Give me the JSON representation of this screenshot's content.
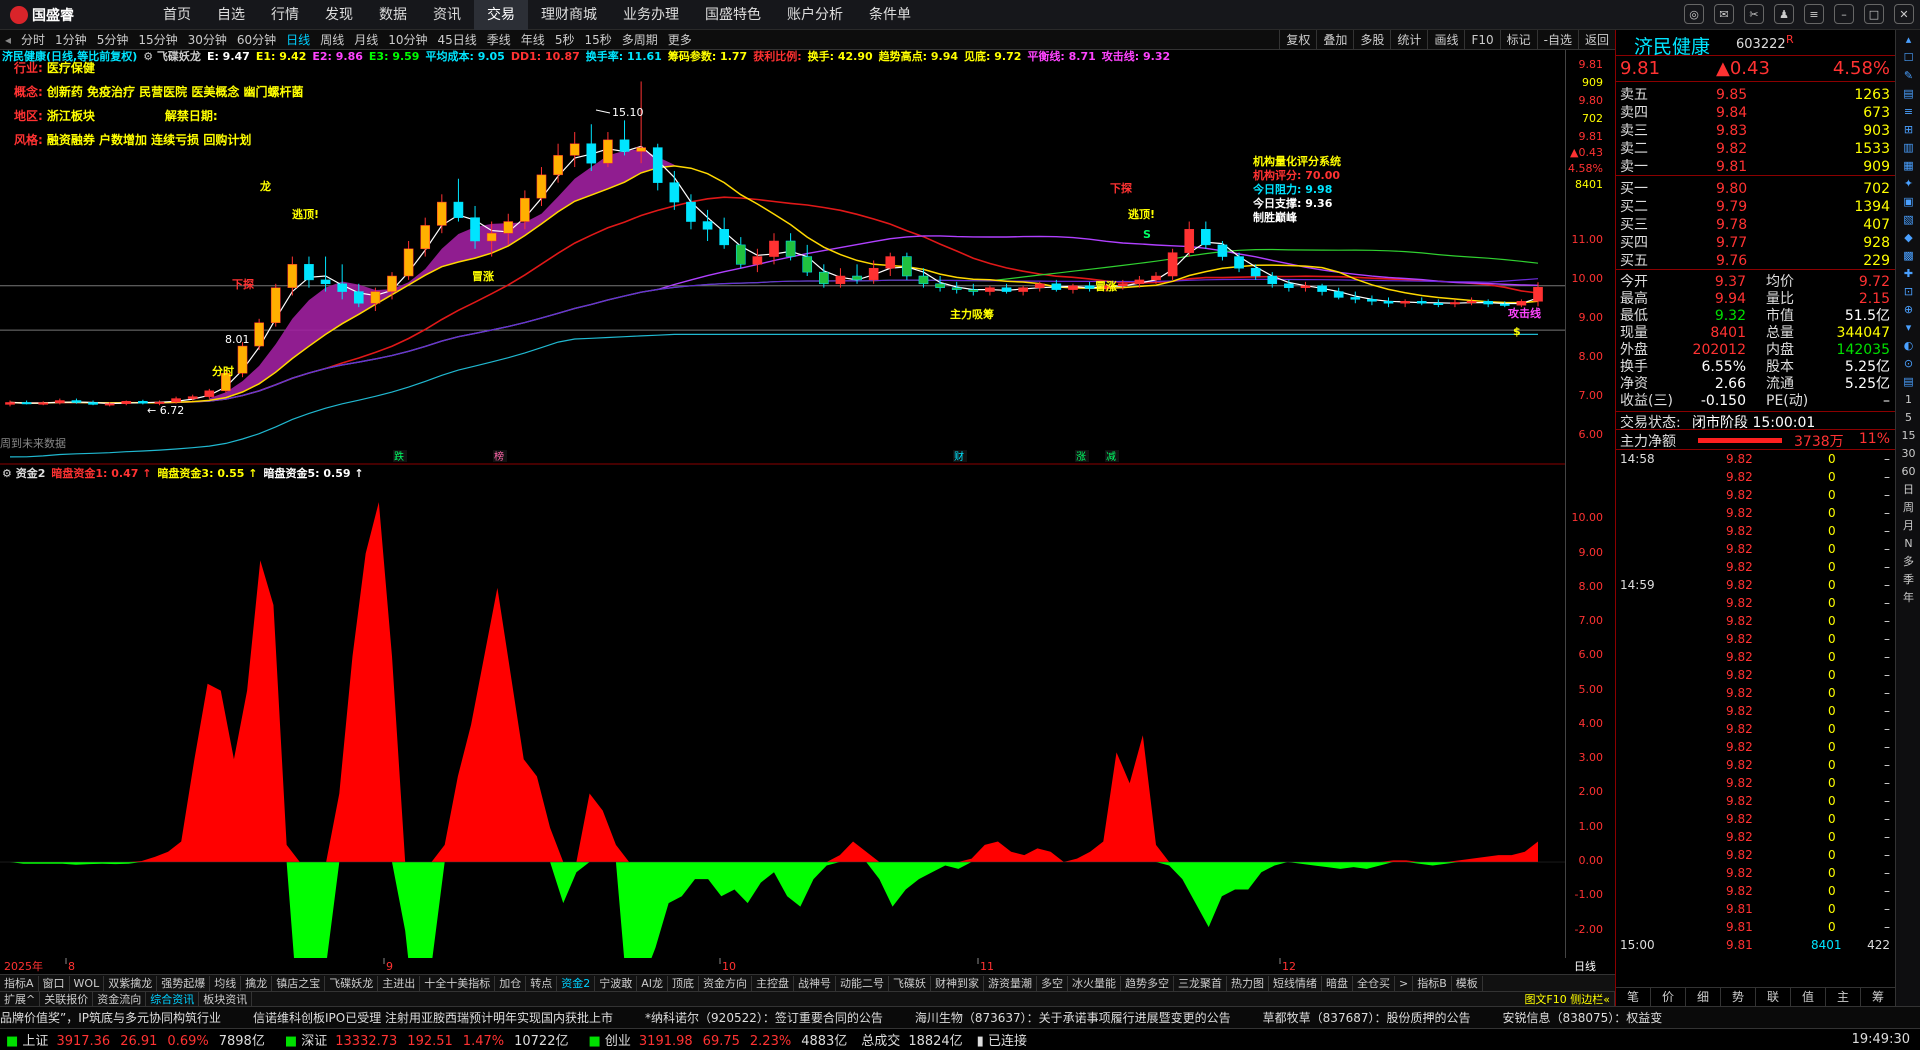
{
  "menubar": {
    "logo": "国盛睿",
    "items": [
      "首页",
      "自选",
      "行情",
      "发现",
      "数据",
      "资讯",
      "交易",
      "理财商城",
      "业务办理",
      "国盛特色",
      "账户分析",
      "条件单"
    ],
    "active": "交易"
  },
  "periods": {
    "items": [
      "分时",
      "1分钟",
      "5分钟",
      "15分钟",
      "30分钟",
      "60分钟",
      "日线",
      "周线",
      "月线",
      "10分钟",
      "45日线",
      "季线",
      "年线",
      "5秒",
      "15秒",
      "多周期",
      "更多"
    ],
    "active": "日线"
  },
  "toolbar": [
    "复权",
    "叠加",
    "多股",
    "统计",
    "画线",
    "F10",
    "标记",
    "-自选",
    "返回"
  ],
  "kline": {
    "title": "济民健康(日线,等比前复权)",
    "indicator_name": "飞碟妖龙",
    "params": [
      {
        "t": "E: 9.47",
        "c": "#ffffff"
      },
      {
        "t": "E1: 9.42",
        "c": "#ffff00"
      },
      {
        "t": "E2: 9.86",
        "c": "#ff44ff"
      },
      {
        "t": "E3: 9.59",
        "c": "#00ff00"
      },
      {
        "t": "平均成本: 9.05",
        "c": "#00e5ff"
      },
      {
        "t": "DD1: 10.87",
        "c": "#ff3232"
      },
      {
        "t": "换手率: 11.61",
        "c": "#00e5ff"
      },
      {
        "t": "筹码参数: 1.77",
        "c": "#ffff00"
      },
      {
        "t": "获利比例:",
        "c": "#ff3232"
      },
      {
        "t": "换手: 42.90",
        "c": "#ffff00"
      },
      {
        "t": "趋势高点: 9.94",
        "c": "#ffff00"
      },
      {
        "t": "见底: 9.72",
        "c": "#ffff00"
      },
      {
        "t": "平衡线: 8.71",
        "c": "#ff44ff"
      },
      {
        "t": "攻击线: 9.32",
        "c": "#ff44ff"
      }
    ],
    "info": [
      {
        "k": "行业:",
        "v": "医疗保健"
      },
      {
        "k": "概念:",
        "v": "创新药 免疫治疗 民营医院 医美概念 幽门螺杆菌"
      },
      {
        "k": "地区:",
        "v": "浙江板块",
        "k2": "解禁日期:"
      },
      {
        "k": "风格:",
        "v": "融资融券 户数增加 连续亏损 回购计划"
      }
    ],
    "system": {
      "title": "机构量化评分系统",
      "score": "机构评分: 70.00",
      "resist": "今日阻力: 9.98",
      "support": "今日支撑: 9.36",
      "note": "制胜巅峰"
    },
    "high_label": "15.10",
    "low_label": "6.72",
    "mid_label": "8.01",
    "annotations": [
      "逃顶!",
      "逃顶!",
      "下探",
      "下探",
      "冒涨",
      "冒涨",
      "主力吸筹",
      "攻击线",
      "龙",
      "分时",
      "$",
      "S"
    ],
    "events": [
      "跌",
      "榜",
      "财",
      "涨",
      "减"
    ],
    "no_data_text": "周到未来数据",
    "price_axis": [
      "9.81",
      "909",
      "9.80",
      "702",
      "9.81",
      "▲0.43",
      "4.58%",
      "8401",
      "11.00",
      "10.00",
      "9.00",
      "8.00",
      "7.00",
      "6.00"
    ]
  },
  "indicator": {
    "name": "资金2",
    "params": [
      {
        "t": "暗盘资金1: 0.47",
        "c": "#ff3232"
      },
      {
        "t": "暗盘资金3: 0.55",
        "c": "#ffff00"
      },
      {
        "t": "暗盘资金5: 0.59",
        "c": "#ffffff"
      }
    ],
    "axis": [
      "10.00",
      "9.00",
      "8.00",
      "7.00",
      "6.00",
      "5.00",
      "4.00",
      "3.00",
      "2.00",
      "1.00",
      "0.00",
      "-1.00",
      "-2.00"
    ]
  },
  "chart_data": {
    "type": "area",
    "title": "资金2",
    "x_months": [
      "8",
      "9",
      "10",
      "11",
      "12"
    ],
    "year_label": "2025年",
    "values": [
      0.0,
      -0.05,
      -0.05,
      -0.05,
      -0.05,
      -0.08,
      -0.06,
      -0.05,
      -0.06,
      -0.05,
      0.03,
      0.15,
      0.3,
      0.6,
      3.0,
      5.2,
      5.0,
      3.0,
      5.0,
      8.8,
      7.5,
      0.5,
      -5.0,
      -5.7,
      -3.0,
      2.0,
      6.0,
      9.0,
      10.5,
      6.0,
      -2.0,
      -5.5,
      -3.0,
      0.5,
      2.5,
      4.0,
      6.0,
      8.0,
      5.5,
      3.0,
      2.5,
      1.0,
      -1.2,
      -0.3,
      2.0,
      1.5,
      0.5,
      -4.5,
      -3.5,
      -2.5,
      -1.2,
      -1.0,
      -0.5,
      -0.5,
      -1.0,
      -0.8,
      -1.2,
      -0.6,
      -0.3,
      -1.0,
      -1.3,
      -0.5,
      -0.1,
      0.2,
      0.6,
      0.3,
      -0.5,
      -1.3,
      -0.8,
      -0.5,
      -0.3,
      -0.1,
      -0.2,
      0.1,
      0.5,
      0.6,
      0.3,
      0.2,
      0.4,
      0.3,
      0.0,
      0.1,
      0.3,
      0.6,
      3.2,
      2.3,
      3.7,
      0.5,
      -0.1,
      -0.5,
      -1.2,
      -1.9,
      -1.0,
      -0.8,
      -0.8,
      -0.3,
      -0.1,
      0.0,
      -0.05,
      -0.1,
      -0.15,
      -0.2,
      -0.15,
      -0.2,
      -0.1,
      0.05,
      0.05,
      -0.05,
      -0.1,
      -0.05,
      0.05,
      0.1,
      0.15,
      0.2,
      0.2,
      0.3,
      0.6
    ],
    "ylim": [
      -2.8,
      11.0
    ]
  },
  "kline_data": {
    "candles": [
      [
        6.8,
        6.9,
        6.75,
        6.85
      ],
      [
        6.85,
        6.9,
        6.8,
        6.82
      ],
      [
        6.82,
        6.88,
        6.78,
        6.84
      ],
      [
        6.84,
        6.95,
        6.8,
        6.9
      ],
      [
        6.9,
        6.95,
        6.82,
        6.85
      ],
      [
        6.85,
        6.9,
        6.78,
        6.8
      ],
      [
        6.8,
        6.86,
        6.75,
        6.82
      ],
      [
        6.82,
        6.9,
        6.78,
        6.88
      ],
      [
        6.88,
        6.92,
        6.8,
        6.83
      ],
      [
        6.83,
        6.9,
        6.78,
        6.86
      ],
      [
        6.86,
        7.0,
        6.82,
        6.95
      ],
      [
        6.95,
        7.05,
        6.9,
        7.0
      ],
      [
        7.0,
        7.2,
        6.95,
        7.15
      ],
      [
        7.15,
        7.7,
        7.1,
        7.6
      ],
      [
        7.6,
        8.4,
        7.5,
        8.3
      ],
      [
        8.3,
        9.0,
        8.2,
        8.9
      ],
      [
        8.9,
        9.9,
        8.8,
        9.8
      ],
      [
        9.8,
        10.6,
        9.6,
        10.4
      ],
      [
        10.4,
        10.6,
        9.8,
        10.0
      ],
      [
        10.0,
        10.6,
        9.7,
        9.9
      ],
      [
        9.9,
        10.4,
        9.5,
        9.7
      ],
      [
        9.7,
        9.9,
        9.3,
        9.4
      ],
      [
        9.4,
        9.8,
        9.2,
        9.7
      ],
      [
        9.7,
        10.2,
        9.5,
        10.1
      ],
      [
        10.1,
        11.0,
        10.0,
        10.8
      ],
      [
        10.8,
        11.6,
        10.6,
        11.4
      ],
      [
        11.4,
        12.2,
        11.2,
        12.0
      ],
      [
        12.0,
        12.6,
        11.5,
        11.6
      ],
      [
        11.6,
        11.9,
        10.8,
        11.0
      ],
      [
        11.0,
        11.5,
        10.6,
        11.2
      ],
      [
        11.2,
        11.7,
        10.9,
        11.5
      ],
      [
        11.5,
        12.3,
        11.3,
        12.1
      ],
      [
        12.1,
        12.9,
        11.9,
        12.7
      ],
      [
        12.7,
        13.5,
        12.5,
        13.2
      ],
      [
        13.2,
        13.8,
        12.9,
        13.5
      ],
      [
        13.5,
        14.0,
        12.8,
        13.0
      ],
      [
        13.0,
        13.8,
        12.9,
        13.6
      ],
      [
        13.6,
        14.1,
        13.2,
        13.3
      ],
      [
        13.3,
        15.1,
        13.0,
        13.4
      ],
      [
        13.4,
        13.5,
        12.3,
        12.5
      ],
      [
        12.5,
        12.8,
        11.8,
        12.0
      ],
      [
        12.0,
        12.2,
        11.3,
        11.5
      ],
      [
        11.5,
        11.8,
        11.0,
        11.3
      ],
      [
        11.3,
        11.6,
        10.8,
        10.9
      ],
      [
        10.9,
        11.1,
        10.3,
        10.4
      ],
      [
        10.4,
        10.8,
        10.2,
        10.6
      ],
      [
        10.6,
        11.2,
        10.4,
        11.0
      ],
      [
        11.0,
        11.2,
        10.5,
        10.6
      ],
      [
        10.6,
        10.9,
        10.1,
        10.2
      ],
      [
        10.2,
        10.4,
        9.8,
        9.9
      ],
      [
        9.9,
        10.3,
        9.8,
        10.1
      ],
      [
        10.1,
        10.4,
        9.9,
        10.0
      ],
      [
        10.0,
        10.5,
        9.9,
        10.3
      ],
      [
        10.3,
        10.7,
        10.1,
        10.6
      ],
      [
        10.6,
        10.7,
        10.0,
        10.1
      ],
      [
        10.1,
        10.3,
        9.8,
        9.9
      ],
      [
        9.9,
        10.1,
        9.7,
        9.8
      ],
      [
        9.8,
        9.95,
        9.65,
        9.75
      ],
      [
        9.75,
        9.9,
        9.6,
        9.7
      ],
      [
        9.7,
        9.85,
        9.6,
        9.8
      ],
      [
        9.8,
        9.9,
        9.65,
        9.7
      ],
      [
        9.7,
        9.85,
        9.6,
        9.8
      ],
      [
        9.8,
        9.95,
        9.7,
        9.9
      ],
      [
        9.9,
        10.0,
        9.7,
        9.75
      ],
      [
        9.75,
        9.9,
        9.65,
        9.85
      ],
      [
        9.85,
        9.95,
        9.7,
        9.78
      ],
      [
        9.78,
        9.9,
        9.7,
        9.85
      ],
      [
        9.85,
        10.0,
        9.75,
        9.9
      ],
      [
        9.9,
        10.1,
        9.8,
        10.0
      ],
      [
        10.0,
        10.2,
        9.9,
        10.1
      ],
      [
        10.1,
        10.8,
        10.0,
        10.7
      ],
      [
        10.7,
        11.5,
        10.6,
        11.3
      ],
      [
        11.3,
        11.5,
        10.8,
        10.9
      ],
      [
        10.9,
        11.0,
        10.5,
        10.6
      ],
      [
        10.6,
        10.7,
        10.2,
        10.3
      ],
      [
        10.3,
        10.4,
        10.0,
        10.1
      ],
      [
        10.1,
        10.2,
        9.8,
        9.9
      ],
      [
        9.9,
        10.0,
        9.7,
        9.8
      ],
      [
        9.8,
        9.95,
        9.7,
        9.85
      ],
      [
        9.85,
        9.9,
        9.6,
        9.7
      ],
      [
        9.7,
        9.8,
        9.5,
        9.55
      ],
      [
        9.55,
        9.7,
        9.4,
        9.5
      ],
      [
        9.5,
        9.6,
        9.35,
        9.45
      ],
      [
        9.45,
        9.55,
        9.3,
        9.4
      ],
      [
        9.4,
        9.5,
        9.3,
        9.45
      ],
      [
        9.45,
        9.55,
        9.35,
        9.4
      ],
      [
        9.4,
        9.5,
        9.3,
        9.38
      ],
      [
        9.38,
        9.5,
        9.3,
        9.42
      ],
      [
        9.42,
        9.55,
        9.35,
        9.45
      ],
      [
        9.45,
        9.5,
        9.3,
        9.38
      ],
      [
        9.38,
        9.45,
        9.3,
        9.35
      ],
      [
        9.35,
        9.5,
        9.3,
        9.45
      ],
      [
        9.45,
        9.94,
        9.32,
        9.81
      ]
    ],
    "ylim": [
      5.5,
      15.6
    ]
  },
  "quote": {
    "name": "济民健康",
    "code": "603222",
    "tag": "R",
    "price": "9.81",
    "change": "▲0.43",
    "pct": "4.58%",
    "asks": [
      {
        "l": "卖五",
        "p": "9.85",
        "v": "1263"
      },
      {
        "l": "卖四",
        "p": "9.84",
        "v": "673"
      },
      {
        "l": "卖三",
        "p": "9.83",
        "v": "903"
      },
      {
        "l": "卖二",
        "p": "9.82",
        "v": "1533"
      },
      {
        "l": "卖一",
        "p": "9.81",
        "v": "909"
      }
    ],
    "bids": [
      {
        "l": "买一",
        "p": "9.80",
        "v": "702"
      },
      {
        "l": "买二",
        "p": "9.79",
        "v": "1394"
      },
      {
        "l": "买三",
        "p": "9.78",
        "v": "407"
      },
      {
        "l": "买四",
        "p": "9.77",
        "v": "928"
      },
      {
        "l": "买五",
        "p": "9.76",
        "v": "229"
      }
    ],
    "stats": [
      {
        "k1": "今开",
        "v1": "9.37",
        "c1": "#ff3232",
        "k2": "均价",
        "v2": "9.72",
        "c2": "#ff3232"
      },
      {
        "k1": "最高",
        "v1": "9.94",
        "c1": "#ff3232",
        "k2": "量比",
        "v2": "2.15",
        "c2": "#ff3232"
      },
      {
        "k1": "最低",
        "v1": "9.32",
        "c1": "#00e000",
        "k2": "市值",
        "v2": "51.5亿",
        "c2": "#ffffff"
      },
      {
        "k1": "现量",
        "v1": "8401",
        "c1": "#ff3232",
        "k2": "总量",
        "v2": "344047",
        "c2": "#ffff00"
      },
      {
        "k1": "外盘",
        "v1": "202012",
        "c1": "#ff3232",
        "k2": "内盘",
        "v2": "142035",
        "c2": "#00e000"
      },
      {
        "k1": "换手",
        "v1": "6.55%",
        "c1": "#ffffff",
        "k2": "股本",
        "v2": "5.25亿",
        "c2": "#ffffff"
      },
      {
        "k1": "净资",
        "v1": "2.66",
        "c1": "#ffffff",
        "k2": "流通",
        "v2": "5.25亿",
        "c2": "#ffffff"
      },
      {
        "k1": "收益(三)",
        "v1": "-0.150",
        "c1": "#ffffff",
        "k2": "PE(动)",
        "v2": "–",
        "c2": "#ffffff"
      }
    ],
    "status_label": "交易状态:",
    "status_value": "闭市阶段 15:00:01",
    "netflow_label": "主力净额",
    "netflow_value": "3738万",
    "netflow_pct": "11%",
    "times": [
      "14:58",
      "14:59",
      "15:00"
    ],
    "trades": [
      "9.82",
      "9.82",
      "9.82",
      "9.82",
      "9.82",
      "9.82",
      "9.82",
      "9.82",
      "9.82",
      "9.82",
      "9.82",
      "9.82",
      "9.82",
      "9.82",
      "9.82",
      "9.82",
      "9.82",
      "9.82",
      "9.82",
      "9.82",
      "9.82",
      "9.82",
      "9.82",
      "9.82",
      "9.82",
      "9.81",
      "9.81"
    ],
    "last_trade": {
      "p": "9.81",
      "v": "8401",
      "n": "422"
    },
    "bottom_tabs": [
      "笔",
      "价",
      "细",
      "势",
      "联",
      "值",
      "主",
      "筹"
    ],
    "trade_zero": "0"
  },
  "right_nav": [
    "日",
    "周",
    "月",
    "N",
    "多",
    "季",
    "年"
  ],
  "tabs1": [
    "指标A",
    "窗口",
    "WOL",
    "双紫擒龙",
    "强势起爆",
    "均线",
    "擒龙",
    "镇店之宝",
    "飞碟妖龙",
    "主进出",
    "十全十美指标",
    "加仓",
    "转点",
    "资金2",
    "宁波敢",
    "AI龙",
    "顶底",
    "资金方向",
    "主控盘",
    "战神号",
    "动能二号",
    "飞碟妖",
    "财神到家",
    "游资量潮",
    "多空",
    "冰火量能",
    "趋势多空",
    "三龙聚首",
    "热力图",
    "短线情绪",
    "暗盘",
    "全仓买",
    ">",
    "指标B",
    "模板"
  ],
  "tabs1_active": "资金2",
  "tabs2": [
    "扩展^",
    "关联报价",
    "资金流向",
    "综合资讯",
    "板块资讯"
  ],
  "tabs2_active": "综合资讯",
  "tabs2_right": "图文F10 侧边栏«",
  "date_axis_right": "日线",
  "ticker": [
    "品牌价值奖”，IP筑底与多元协同构筑行业",
    "信诺维科创板IPO已受理 注射用亚胺西瑞预计明年实现国内获批上市",
    "*纳科诺尔（920522）：签订重要合同的公告",
    "海川生物（873637）：关于承诺事项履行进展暨变更的公告",
    "草都牧草（837687）：股份质押的公告",
    "安锐信息（838075）：权益变"
  ],
  "statusbar": [
    {
      "k": "上证",
      "v": "3917.36",
      "c": "26.91",
      "p": "0.69%",
      "a": "7898亿"
    },
    {
      "k": "深证",
      "v": "13332.73",
      "c": "192.51",
      "p": "1.47%",
      "a": "10722亿"
    },
    {
      "k": "创业",
      "v": "3191.98",
      "c": "69.75",
      "p": "2.23%",
      "a": "4883亿"
    }
  ],
  "status_total_label": "总成交",
  "status_total": "18824亿",
  "status_conn": "已连接",
  "status_time": "19:49:30"
}
